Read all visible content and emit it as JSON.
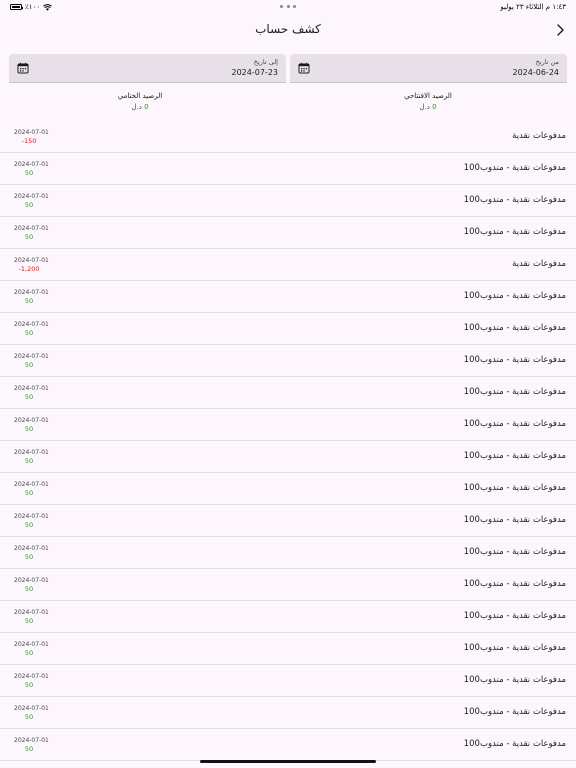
{
  "status_bar": {
    "time_date": "١:٤٣ م   الثلاثاء ٢٣ يوليو",
    "battery": "٪١٠٠"
  },
  "header": {
    "title": "كشف حساب"
  },
  "date_from": {
    "label": "من تاريخ",
    "value": "2024-06-24"
  },
  "date_to": {
    "label": "إلى تاريخ",
    "value": "2024-07-23"
  },
  "balances": {
    "opening": {
      "label": "الرصيد الافتتاحي",
      "value": "0",
      "currency": "د.ل"
    },
    "closing": {
      "label": "الرصيد الختامي",
      "value": "0",
      "currency": "د.ل"
    }
  },
  "transactions": [
    {
      "description": "مدفوعات نقدية",
      "date": "2024-07-01",
      "amount": "-150"
    },
    {
      "description": "مدفوعات نقدية - مندوب100",
      "date": "2024-07-01",
      "amount": "50"
    },
    {
      "description": "مدفوعات نقدية - مندوب100",
      "date": "2024-07-01",
      "amount": "50"
    },
    {
      "description": "مدفوعات نقدية - مندوب100",
      "date": "2024-07-01",
      "amount": "50"
    },
    {
      "description": "مدفوعات نقدية",
      "date": "2024-07-01",
      "amount": "-1,200"
    },
    {
      "description": "مدفوعات نقدية - مندوب100",
      "date": "2024-07-01",
      "amount": "50"
    },
    {
      "description": "مدفوعات نقدية - مندوب100",
      "date": "2024-07-01",
      "amount": "50"
    },
    {
      "description": "مدفوعات نقدية - مندوب100",
      "date": "2024-07-01",
      "amount": "50"
    },
    {
      "description": "مدفوعات نقدية - مندوب100",
      "date": "2024-07-01",
      "amount": "50"
    },
    {
      "description": "مدفوعات نقدية - مندوب100",
      "date": "2024-07-01",
      "amount": "50"
    },
    {
      "description": "مدفوعات نقدية - مندوب100",
      "date": "2024-07-01",
      "amount": "50"
    },
    {
      "description": "مدفوعات نقدية - مندوب100",
      "date": "2024-07-01",
      "amount": "50"
    },
    {
      "description": "مدفوعات نقدية - مندوب100",
      "date": "2024-07-01",
      "amount": "50"
    },
    {
      "description": "مدفوعات نقدية - مندوب100",
      "date": "2024-07-01",
      "amount": "50"
    },
    {
      "description": "مدفوعات نقدية - مندوب100",
      "date": "2024-07-01",
      "amount": "50"
    },
    {
      "description": "مدفوعات نقدية - مندوب100",
      "date": "2024-07-01",
      "amount": "50"
    },
    {
      "description": "مدفوعات نقدية - مندوب100",
      "date": "2024-07-01",
      "amount": "50"
    },
    {
      "description": "مدفوعات نقدية - مندوب100",
      "date": "2024-07-01",
      "amount": "50"
    },
    {
      "description": "مدفوعات نقدية - مندوب100",
      "date": "2024-07-01",
      "amount": "50"
    },
    {
      "description": "مدفوعات نقدية - مندوب100",
      "date": "2024-07-01",
      "amount": "50"
    }
  ],
  "colors": {
    "positive": "#1e9b22",
    "negative": "#d32020",
    "field_bg": "#e7e0e9",
    "page_bg": "#fdf7fd"
  },
  "icons": {
    "back": "chevron-right-icon",
    "calendar": "calendar-icon",
    "wifi": "wifi-icon",
    "battery": "battery-icon"
  }
}
